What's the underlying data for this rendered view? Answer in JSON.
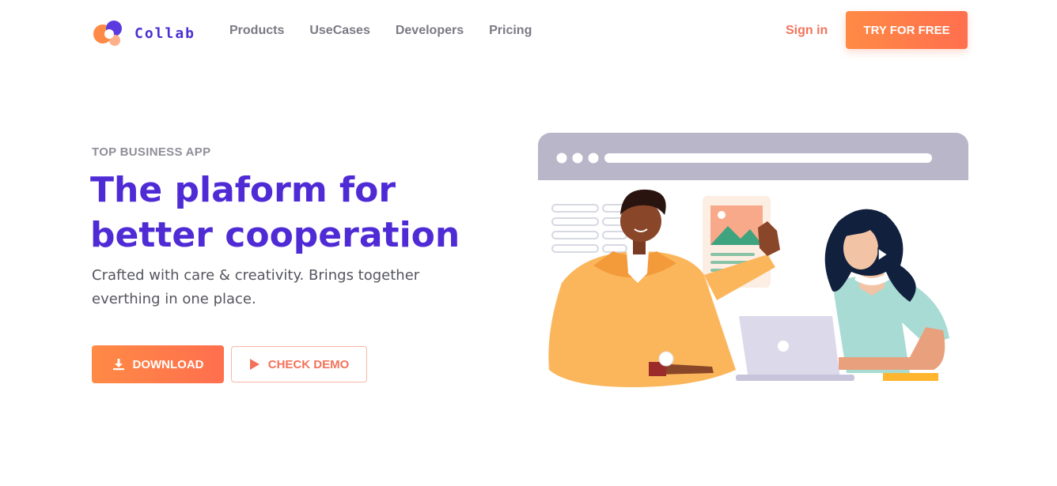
{
  "header": {
    "brand": "Collab",
    "nav": [
      {
        "label": "Products"
      },
      {
        "label": "UseCases"
      },
      {
        "label": "Developers"
      },
      {
        "label": "Pricing"
      }
    ],
    "sign_in_label": "Sign in",
    "cta_label": "TRY FOR FREE"
  },
  "hero": {
    "eyebrow": "TOP BUSINESS APP",
    "headline_line1": "The plaform for",
    "headline_line2": "better cooperation",
    "subtext": "Crafted with care & creativity. Brings together everthing in one place.",
    "download_label": "DOWNLOAD",
    "demo_label": "CHECK DEMO"
  },
  "icons": {
    "logo": "collab-logo",
    "download": "download-icon",
    "play": "play-icon"
  },
  "colors": {
    "brand_purple": "#4f2bd6",
    "accent_orange": "#ff7a4a",
    "nav_gray": "#7a7a85",
    "browser_bar": "#b9b6c9"
  }
}
